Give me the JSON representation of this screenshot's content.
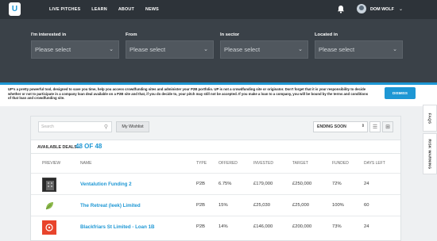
{
  "nav": {
    "logo_text": "U",
    "links": [
      "LIVE PITCHES",
      "LEARN",
      "ABOUT",
      "NEWS"
    ],
    "user_name": "DOM WOLF"
  },
  "filters": [
    {
      "label": "I'm interested in",
      "placeholder": "Please select"
    },
    {
      "label": "From",
      "placeholder": "Please select"
    },
    {
      "label": "In sector",
      "placeholder": "Please select"
    },
    {
      "label": "Located in",
      "placeholder": "Please select"
    }
  ],
  "notice": {
    "bold": "UP's a pretty powerful tool, designed to save you time, help you access crowdfunding sites and administer your P2B portfolio. UP is not a crowdfunding site or originator. Don't forget that it is your responsibility to decide whether or not to participate in a company loan deal available on a P2B site and that, if you do decide to, your pitch may still not be accepted. If you make a loan to a company, you will be bound by the terms and conditions of that loan and crowdfunding site.",
    "dismiss_label": "DISMISS"
  },
  "toolbar": {
    "search_placeholder": "Search",
    "wishlist_label": "My Wishlist",
    "sort_label": "ENDING SOON"
  },
  "deals": {
    "available_label": "AVAILABLE DEALS...",
    "count_text": "48 OF 48"
  },
  "table": {
    "headers": [
      "PREVIEW",
      "NAME",
      "TYPE",
      "OFFERED",
      "INVESTED",
      "TARGET",
      "FUNDED",
      "DAYS LEFT"
    ],
    "rows": [
      {
        "name": "Ventalution Funding 2",
        "type": "P2B",
        "offered": "6.75%",
        "invested": "£179,000",
        "target": "£250,000",
        "funded": "72%",
        "days_left": "24"
      },
      {
        "name": "The Retreat (leek) Limited",
        "type": "P2B",
        "offered": "15%",
        "invested": "£25,030",
        "target": "£25,000",
        "funded": "100%",
        "days_left": "60"
      },
      {
        "name": "Blackfriars St Limited - Loan 1B",
        "type": "P2B",
        "offered": "14%",
        "invested": "£146,000",
        "target": "£200,000",
        "funded": "73%",
        "days_left": "24"
      }
    ]
  },
  "side_tabs": [
    "FAQS",
    "RISK WARNING"
  ],
  "colors": {
    "accent": "#1e97d4",
    "nav_bg": "#2d3339",
    "filter_bg": "#3a4148"
  }
}
